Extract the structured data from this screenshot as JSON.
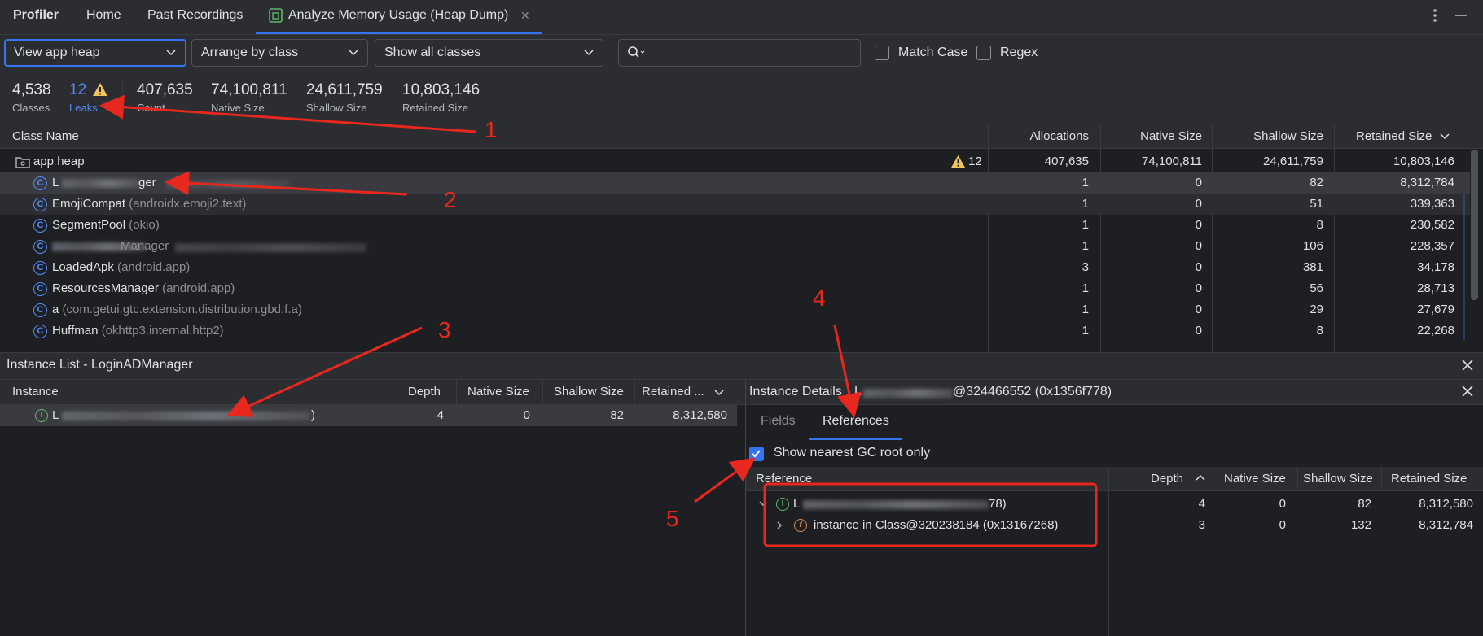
{
  "tabs": {
    "profiler": "Profiler",
    "home": "Home",
    "past_recordings": "Past Recordings",
    "analyze": "Analyze Memory Usage (Heap Dump)",
    "close": "✕"
  },
  "toolbar": {
    "view_value": "View app heap",
    "arrange_value": "Arrange by class",
    "filter_value": "Show all classes",
    "search_placeholder": "",
    "match_case": "Match Case",
    "regex": "Regex"
  },
  "stats": {
    "classes_value": "4,538",
    "classes_label": "Classes",
    "leaks_value": "12",
    "leaks_label": "Leaks",
    "count_value": "407,635",
    "count_label": "Count",
    "native_value": "74,100,811",
    "native_label": "Native Size",
    "shallow_value": "24,611,759",
    "shallow_label": "Shallow Size",
    "retained_value": "10,803,146",
    "retained_label": "Retained Size"
  },
  "class_table": {
    "headers": {
      "name": "Class Name",
      "alloc": "Allocations",
      "native": "Native Size",
      "shallow": "Shallow Size",
      "retained": "Retained Size"
    },
    "root": {
      "name": "app heap",
      "leaks": "12",
      "alloc": "407,635",
      "native": "74,100,811",
      "shallow": "24,611,759",
      "retained": "10,803,146"
    },
    "rows": [
      {
        "name": "L",
        "name_tail": "ger",
        "pkg": "",
        "alloc": "1",
        "native": "0",
        "shallow": "82",
        "retained": "8,312,784"
      },
      {
        "name": "EmojiCompat",
        "pkg": "(androidx.emoji2.text)",
        "alloc": "1",
        "native": "0",
        "shallow": "51",
        "retained": "339,363"
      },
      {
        "name": "SegmentPool",
        "pkg": "(okio)",
        "alloc": "1",
        "native": "0",
        "shallow": "8",
        "retained": "230,582"
      },
      {
        "name": "",
        "name_tail": "Manager",
        "pkg": "",
        "alloc": "1",
        "native": "0",
        "shallow": "106",
        "retained": "228,357"
      },
      {
        "name": "LoadedApk",
        "pkg": "(android.app)",
        "alloc": "3",
        "native": "0",
        "shallow": "381",
        "retained": "34,178"
      },
      {
        "name": "ResourcesManager",
        "pkg": "(android.app)",
        "alloc": "1",
        "native": "0",
        "shallow": "56",
        "retained": "28,713"
      },
      {
        "name": "a",
        "pkg": "(com.getui.gtc.extension.distribution.gbd.f.a)",
        "alloc": "1",
        "native": "0",
        "shallow": "29",
        "retained": "27,679"
      },
      {
        "name": "Huffman",
        "pkg": "(okhttp3.internal.http2)",
        "alloc": "1",
        "native": "0",
        "shallow": "8",
        "retained": "22,268"
      }
    ]
  },
  "instance_list": {
    "title": "Instance List - LoginADManager",
    "headers": {
      "instance": "Instance",
      "depth": "Depth",
      "native": "Native Size",
      "shallow": "Shallow Size",
      "retained": "Retained ..."
    },
    "row": {
      "name": "L",
      "name_tail": ")",
      "depth": "4",
      "native": "0",
      "shallow": "82",
      "retained": "8,312,580"
    }
  },
  "instance_details": {
    "title": "Instance Details",
    "title_head": "L",
    "title_tail": "@324466552 (0x1356f778)",
    "tab_fields": "Fields",
    "tab_references": "References",
    "gc_root_label": "Show nearest GC root only",
    "headers": {
      "reference": "Reference",
      "depth": "Depth",
      "native": "Native Size",
      "shallow": "Shallow Size",
      "retained": "Retained Size"
    },
    "rows": [
      {
        "name": "L",
        "name_tail": "78)",
        "depth": "4",
        "native": "0",
        "shallow": "82",
        "retained": "8,312,580"
      },
      {
        "name": "instance in Class@320238184 (0x13167268)",
        "depth": "3",
        "native": "0",
        "shallow": "132",
        "retained": "8,312,784"
      }
    ]
  },
  "annotations": {
    "n1": "1",
    "n2": "2",
    "n3": "3",
    "n4": "4",
    "n5": "5"
  }
}
